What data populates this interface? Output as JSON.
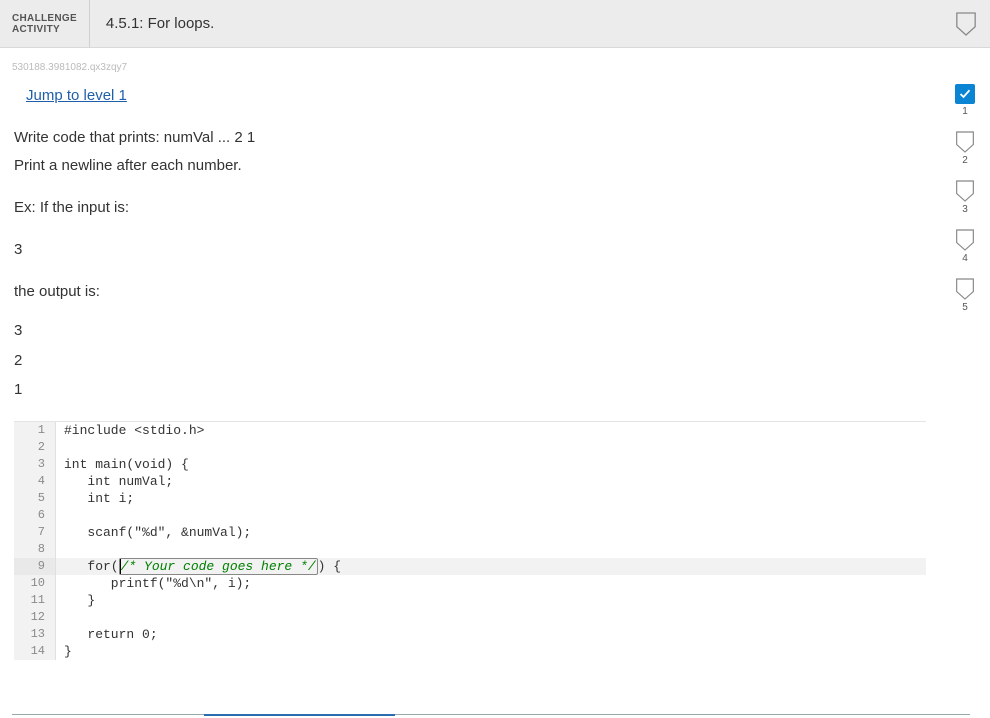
{
  "header": {
    "label_line1": "CHALLENGE",
    "label_line2": "ACTIVITY",
    "title": "4.5.1: For loops."
  },
  "hash": "530188.3981082.qx3zqy7",
  "jump_link": "Jump to level 1",
  "problem": {
    "line1": "Write code that prints: numVal ... 2 1",
    "line2": "Print a newline after each number.",
    "ex_label": "Ex: If the input is:",
    "input_sample": "3",
    "output_label": "the output is:",
    "output_l1": "3",
    "output_l2": "2",
    "output_l3": "1"
  },
  "code": {
    "l1": "#include <stdio.h>",
    "l2": "",
    "l3": "int main(void) {",
    "l4": "   int numVal;",
    "l5": "   int i;",
    "l6": "",
    "l7": "   scanf(\"%d\", &numVal);",
    "l8": "",
    "l9a": "   for(",
    "l9b": "/* Your code goes here */",
    "l9c": ") {",
    "l10": "      printf(\"%d\\n\", i);",
    "l11": "   }",
    "l12": "",
    "l13": "   return 0;",
    "l14": "}"
  },
  "progress": {
    "steps": [
      "1",
      "2",
      "3",
      "4",
      "5"
    ],
    "active_index": 0
  }
}
